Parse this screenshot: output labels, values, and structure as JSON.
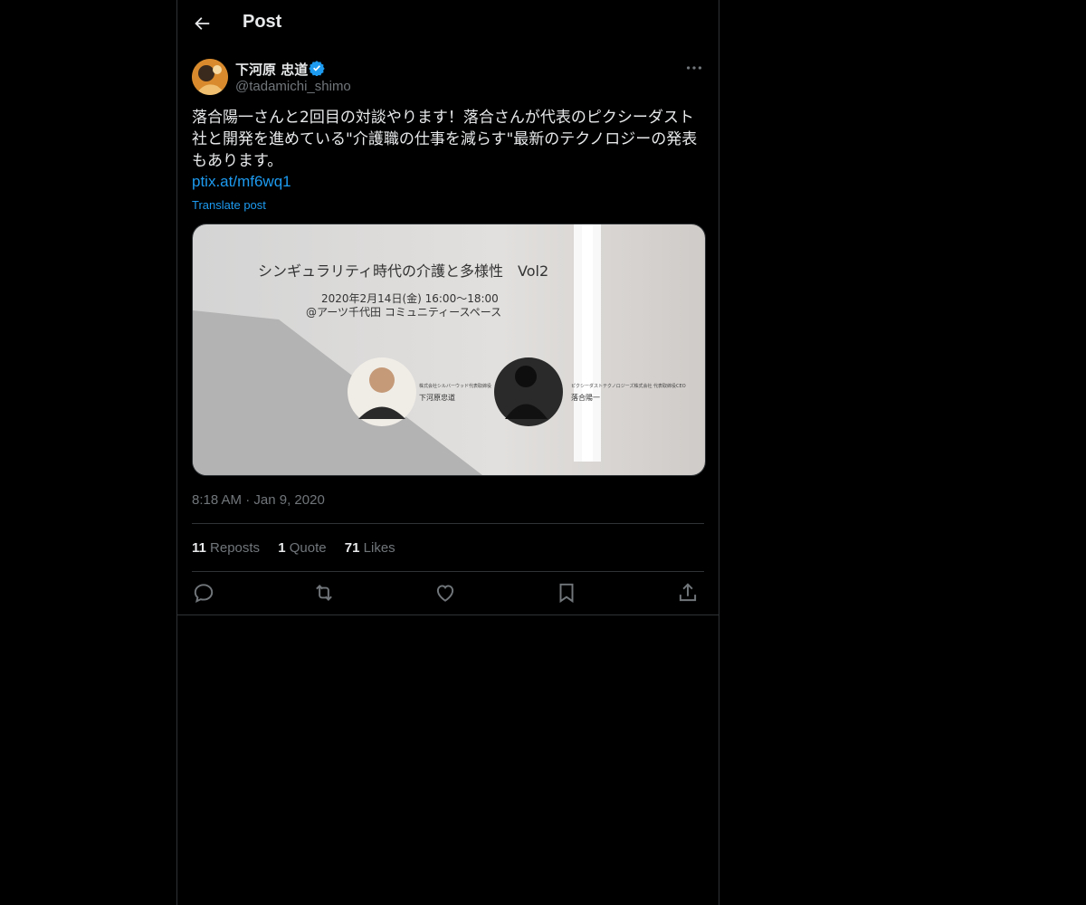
{
  "header": {
    "title": "Post",
    "back_icon": "arrow-left-icon"
  },
  "author": {
    "display_name": "下河原 忠道",
    "handle": "@tadamichi_shimo",
    "verified": true,
    "verified_color": "#1d9bf0"
  },
  "post": {
    "text": "落合陽一さんと2回目の対談やります！落合さんが代表のピクシーダスト社と開発を進めている\"介護職の仕事を減らす\"最新のテクノロジーの発表もあります。",
    "link": "ptix.at/mf6wq1",
    "translate_label": "Translate post",
    "time": "8:18 AM",
    "date": "Jan 9, 2020"
  },
  "media": {
    "title": "シンギュラリティ時代の介護と多様性　Vol2",
    "datetime": "2020年2月14日(金) 16:00〜18:00",
    "venue": "@アーツ千代田 コミュニティースペース",
    "speaker1_affiliation": "株式会社シルバーウッド代表取締役",
    "speaker1_name": "下河原忠道",
    "speaker2_affiliation": "ピクシーダストテクノロジーズ株式会社 代表取締役CEO",
    "speaker2_name": "落合陽一"
  },
  "stats": {
    "reposts_count": "11",
    "reposts_label": "Reposts",
    "quotes_count": "1",
    "quotes_label": "Quote",
    "likes_count": "71",
    "likes_label": "Likes"
  },
  "colors": {
    "background": "#000000",
    "text": "#e7e9ea",
    "muted": "#71767b",
    "accent": "#1d9bf0",
    "border": "#2f3336"
  }
}
